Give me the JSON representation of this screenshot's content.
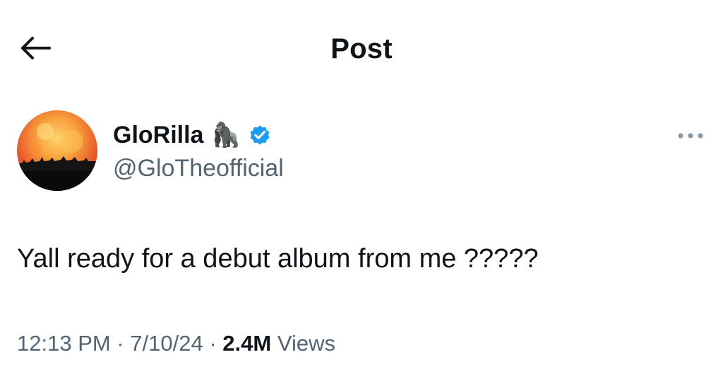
{
  "header": {
    "title": "Post"
  },
  "author": {
    "display_name": "GloRilla",
    "emoji": "🦍",
    "handle": "@GloTheofficial",
    "verified": true,
    "verified_color": "#1d9bf0"
  },
  "tweet": {
    "text": "Yall ready for a debut album from me ?????",
    "time": "12:13 PM",
    "separator": "·",
    "date": "7/10/24",
    "views_count": "2.4M",
    "views_label": "Views"
  },
  "icons": {
    "back": "arrow-left-icon",
    "more": "more-horizontal-icon",
    "verified": "verified-badge-icon"
  }
}
